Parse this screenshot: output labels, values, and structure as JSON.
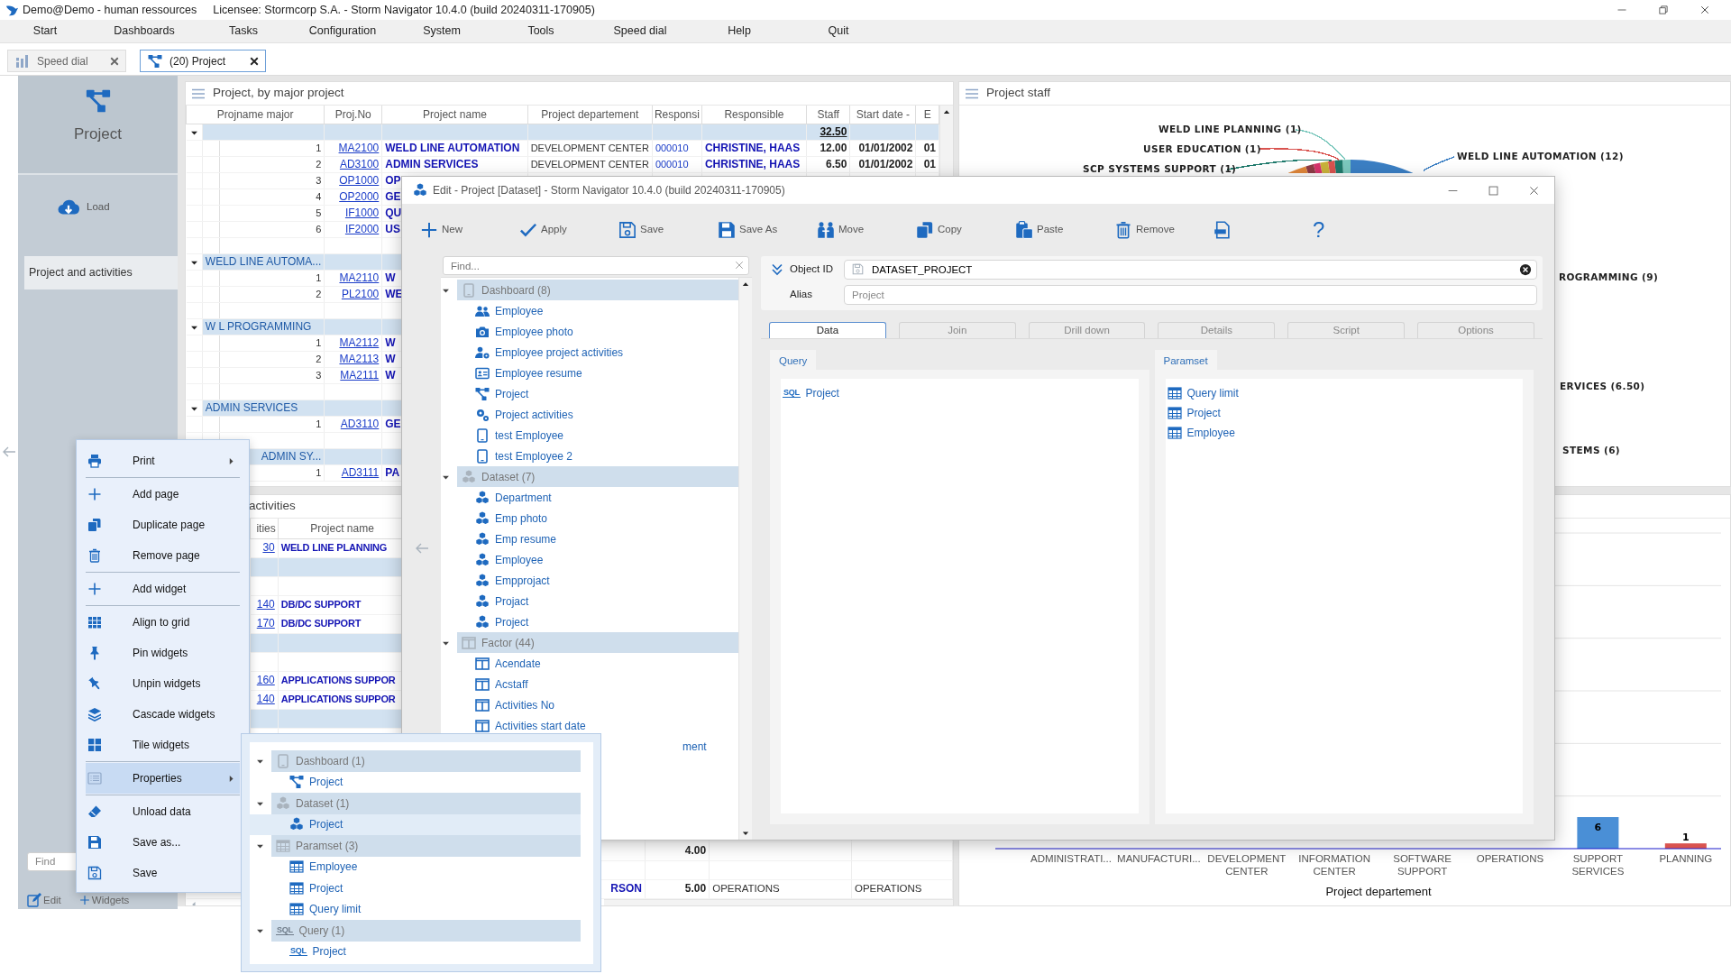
{
  "app": {
    "title": "Demo@Demo - human ressources",
    "license": "Licensee: Stormcorp S.A. - Storm Navigator 10.4.0 (build 20240311-170905)"
  },
  "menu": [
    "Start",
    "Dashboards",
    "Tasks",
    "Configuration",
    "System",
    "Tools",
    "Speed dial",
    "Help",
    "Quit"
  ],
  "tabs": [
    {
      "label": "Speed dial",
      "kind": "speed",
      "selected": false
    },
    {
      "label": "(20) Project",
      "kind": "network",
      "selected": true
    }
  ],
  "sidebar": {
    "title": "Project",
    "load": "Load",
    "items": [
      {
        "label": "Project and activities",
        "selected": true
      }
    ],
    "find_placeholder": "Find",
    "edit": "Edit",
    "widgets": "Widgets"
  },
  "project_table": {
    "title": "Project, by major project",
    "columns": [
      "Projname major",
      "Proj.No",
      "Project name",
      "Project departement",
      "Responsi",
      "Responsible",
      "Staff",
      "Start date -",
      "E"
    ],
    "rows": [
      {
        "kind": "group",
        "expanded": true,
        "total": "32.50"
      },
      {
        "kind": "item",
        "cells": [
          "1",
          "MA2100",
          "WELD LINE AUTOMATION",
          "DEVELOPMENT CENTER",
          "000010",
          "CHRISTINE, HAAS",
          "12.00",
          "01/01/2002",
          "01"
        ]
      },
      {
        "kind": "item",
        "cells": [
          "2",
          "AD3100",
          "ADMIN SERVICES",
          "DEVELOPMENT CENTER",
          "000010",
          "CHRISTINE, HAAS",
          "6.50",
          "01/01/2002",
          "01"
        ]
      },
      {
        "kind": "item",
        "cells": [
          "3",
          "OP1000",
          "OP"
        ]
      },
      {
        "kind": "item",
        "cells": [
          "4",
          "OP2000",
          "GE"
        ]
      },
      {
        "kind": "item",
        "cells": [
          "5",
          "IF1000",
          "QU"
        ]
      },
      {
        "kind": "item",
        "cells": [
          "6",
          "IF2000",
          "US"
        ]
      },
      {
        "kind": "blank"
      },
      {
        "kind": "group",
        "expanded": true,
        "label": "WELD LINE AUTOMA..."
      },
      {
        "kind": "item",
        "cells": [
          "1",
          "MA2110",
          "W"
        ]
      },
      {
        "kind": "item",
        "cells": [
          "2",
          "PL2100",
          "WE"
        ]
      },
      {
        "kind": "blank"
      },
      {
        "kind": "group",
        "expanded": true,
        "label": "W L PROGRAMMING"
      },
      {
        "kind": "item",
        "cells": [
          "1",
          "MA2112",
          "W"
        ]
      },
      {
        "kind": "item",
        "cells": [
          "2",
          "MA2113",
          "W"
        ]
      },
      {
        "kind": "item",
        "cells": [
          "3",
          "MA2111",
          "W"
        ]
      },
      {
        "kind": "blank"
      },
      {
        "kind": "group",
        "expanded": true,
        "label": "ADMIN SERVICES"
      },
      {
        "kind": "item",
        "cells": [
          "1",
          "AD3110",
          "GE"
        ]
      },
      {
        "kind": "blank"
      },
      {
        "kind": "group",
        "label": "ADMIN SY...",
        "clipped_start": true
      },
      {
        "kind": "item",
        "cells": [
          "1",
          "AD3111",
          "PA"
        ]
      }
    ]
  },
  "staff_chart": {
    "title": "Project staff",
    "labels": [
      {
        "text": "WELD LINE PLANNING (1)",
        "color": "#7cc8bd"
      },
      {
        "text": "USER EDUCATION (1)",
        "color": "#d9534f"
      },
      {
        "text": "SCP SYSTEMS SUPPORT (1)",
        "color": "#1f7a6c"
      },
      {
        "text": "WELD LINE AUTOMATION (12)",
        "color": "#3b7fc4"
      },
      {
        "text": "ROGRAMMING (9)"
      },
      {
        "text": "ERVICES (6.50)"
      },
      {
        "text": "STEMS (6)"
      }
    ]
  },
  "activities": {
    "title": "activities",
    "clipped_start": true,
    "columns": [
      "ities",
      "Project name"
    ],
    "rows": [
      {
        "kind": "item",
        "cells": {
          "ities": "30",
          "project_name": "WELD LINE PLANNING"
        }
      },
      {
        "kind": "group"
      },
      {
        "kind": "blank"
      },
      {
        "kind": "item",
        "cells": {
          "ities": "140",
          "project_name": "DB/DC SUPPORT"
        }
      },
      {
        "kind": "item",
        "cells": {
          "ities": "170",
          "project_name": "DB/DC SUPPORT"
        }
      },
      {
        "kind": "group"
      },
      {
        "kind": "blank"
      },
      {
        "kind": "item",
        "cells": {
          "ities": "160",
          "project_name": "APPLICATIONS SUPPOR"
        }
      },
      {
        "kind": "item",
        "cells": {
          "ities": "140",
          "project_name": "APPLICATIONS SUPPOR"
        }
      },
      {
        "kind": "group"
      },
      {
        "kind": "blank"
      },
      {
        "kind": "blank"
      },
      {
        "kind": "blank"
      },
      {
        "kind": "blank"
      },
      {
        "kind": "blank"
      },
      {
        "kind": "blank"
      },
      {
        "kind": "item",
        "cells": {
          "column_5": "4.00"
        }
      },
      {
        "kind": "blank"
      },
      {
        "kind": "item",
        "cells": {
          "column_4": "RSON",
          "column_5": "5.00",
          "column_6": "OPERATIONS",
          "column_7": "OPERATIONS"
        }
      }
    ]
  },
  "dept_chart": {
    "chart_data": {
      "type": "bar",
      "xlabel": "Project departement",
      "categories": [
        "ADMINISTRATI...",
        "MANUFACTURI...",
        "DEVELOPMENT CENTER",
        "INFORMATION CENTER",
        "SOFTWARE SUPPORT",
        "OPERATIONS",
        "SUPPORT SERVICES",
        "PLANNING"
      ],
      "values": [
        null,
        null,
        null,
        null,
        null,
        null,
        6,
        1
      ],
      "colors": [
        null,
        null,
        null,
        null,
        null,
        null,
        "#4a8fd6",
        "#d9534f"
      ],
      "ylim": [
        0,
        60
      ],
      "data_labels": true
    }
  },
  "dialog": {
    "title": "Edit - Project [Dataset] -  Storm Navigator 10.4.0 (build 20240311-170905)",
    "toolbar": [
      {
        "label": "New",
        "kind": "plus"
      },
      {
        "label": "Apply",
        "kind": "check"
      },
      {
        "label": "Save",
        "kind": "floppyo"
      },
      {
        "label": "Save As",
        "kind": "floppy"
      },
      {
        "label": "Move",
        "kind": "people"
      },
      {
        "label": "Copy",
        "kind": "copy"
      },
      {
        "label": "Paste",
        "kind": "paste"
      },
      {
        "label": "Remove",
        "kind": "trash"
      },
      {
        "kind": "xmldoc"
      },
      {
        "glyph": "?",
        "kind": "help"
      }
    ],
    "find_placeholder": "Find...",
    "tree": [
      {
        "label": "Dashboard (8)",
        "kind": "tablet",
        "expanded": true,
        "children": [
          {
            "label": "Employee",
            "kind": "users"
          },
          {
            "label": "Employee photo",
            "kind": "camera"
          },
          {
            "label": "Employee project activities",
            "kind": "usergear"
          },
          {
            "label": "Employee resume",
            "kind": "idcard"
          },
          {
            "label": "Project",
            "kind": "network"
          },
          {
            "label": "Project activities",
            "kind": "gears"
          },
          {
            "label": "test Employee",
            "kind": "tablet"
          },
          {
            "label": "test Employee 2",
            "kind": "tablet"
          }
        ]
      },
      {
        "label": "Dataset (7)",
        "kind": "cubes",
        "expanded": true,
        "children": [
          {
            "label": "Department",
            "kind": "cubes"
          },
          {
            "label": "Emp photo",
            "kind": "cubes"
          },
          {
            "label": "Emp resume",
            "kind": "cubes"
          },
          {
            "label": "Employee",
            "kind": "cubes"
          },
          {
            "label": "Empprojact",
            "kind": "cubes"
          },
          {
            "label": "Projact",
            "kind": "cubes"
          },
          {
            "label": "Project",
            "kind": "cubes"
          }
        ]
      },
      {
        "label": "Factor (44)",
        "kind": "columns",
        "expanded": true,
        "children": [
          {
            "label": "Acendate",
            "kind": "columns"
          },
          {
            "label": "Acstaff",
            "kind": "columns"
          },
          {
            "label": "Activities No",
            "kind": "columns"
          },
          {
            "label": "Activities start date",
            "kind": "columns"
          },
          {
            "label": "ment",
            "clipped_start": true
          }
        ]
      }
    ],
    "object_id_label": "Object ID",
    "object_id": "DATASET_PROJECT",
    "alias_label": "Alias",
    "alias_placeholder": "Project",
    "tabs": [
      {
        "label": "Data",
        "selected": true
      },
      {
        "label": "Join",
        "selected": false
      },
      {
        "label": "Drill down",
        "selected": false
      },
      {
        "label": "Details",
        "selected": false
      },
      {
        "label": "Script",
        "selected": false
      },
      {
        "label": "Options",
        "selected": false
      }
    ],
    "query": {
      "title": "Query",
      "items": [
        {
          "label": "Project",
          "kind": "sql",
          "icon_text": "SQL"
        }
      ]
    },
    "paramset": {
      "title": "Paramset",
      "items": [
        {
          "label": "Query limit",
          "kind": "table"
        },
        {
          "label": "Project",
          "kind": "table"
        },
        {
          "label": "Employee",
          "kind": "table"
        }
      ]
    }
  },
  "context_menu": [
    {
      "label": "Print",
      "kind": "printer",
      "submenu": true,
      "divider_after": true,
      "selected": false
    },
    {
      "label": "Add page",
      "kind": "plus",
      "selected": false
    },
    {
      "label": "Duplicate page",
      "kind": "copy",
      "selected": false
    },
    {
      "label": "Remove page",
      "kind": "trash",
      "divider_after": true,
      "selected": false
    },
    {
      "label": "Add widget",
      "kind": "plus",
      "divider_after": true,
      "selected": false
    },
    {
      "label": "Align to grid",
      "kind": "grid",
      "selected": false
    },
    {
      "label": "Pin widgets",
      "kind": "pin",
      "selected": false
    },
    {
      "label": "Unpin widgets",
      "kind": "unpin",
      "selected": false
    },
    {
      "label": "Cascade widgets",
      "kind": "layers",
      "selected": false
    },
    {
      "label": "Tile widgets",
      "kind": "tiles",
      "divider_after": true,
      "selected": false
    },
    {
      "label": "Properties",
      "kind": "listbox",
      "submenu": true,
      "divider_after": true,
      "selected": true
    },
    {
      "label": "Unload data",
      "kind": "eraser",
      "selected": false
    },
    {
      "label": "Save as...",
      "kind": "floppy",
      "selected": false
    },
    {
      "label": "Save",
      "kind": "floppyo",
      "selected": false
    }
  ],
  "properties_menu": [
    {
      "label": "Dashboard (1)",
      "kind": "tablet",
      "expanded": true,
      "children": [
        {
          "label": "Project",
          "kind": "network",
          "selected": false
        }
      ]
    },
    {
      "label": "Dataset (1)",
      "kind": "cubes",
      "expanded": true,
      "children": [
        {
          "label": "Project",
          "kind": "cubes",
          "selected": true
        }
      ]
    },
    {
      "label": "Paramset (3)",
      "kind": "table",
      "expanded": true,
      "children": [
        {
          "label": "Employee",
          "kind": "table",
          "selected": false
        },
        {
          "label": "Project",
          "kind": "table",
          "selected": false
        },
        {
          "label": "Query limit",
          "kind": "table",
          "selected": false
        }
      ]
    },
    {
      "label": "Query (1)",
      "kind": "sql",
      "icon_text": "SQL",
      "expanded": true,
      "children": [
        {
          "label": "Project",
          "kind": "sql",
          "icon_text": "SQL",
          "selected": false
        }
      ]
    }
  ]
}
